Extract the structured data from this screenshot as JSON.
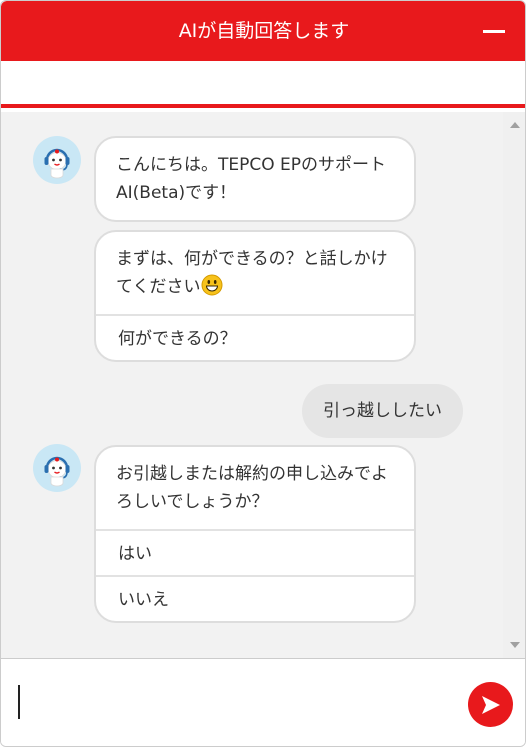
{
  "header": {
    "title": "AIが自動回答します",
    "minimize_icon": "minus-icon"
  },
  "colors": {
    "brand_red": "#e8191c",
    "chat_background": "#f2f2f2",
    "user_bubble": "#e5e5e5",
    "avatar_background": "#c9e7f5"
  },
  "messages": [
    {
      "sender": "bot",
      "avatar_icon": "robot-operator-icon",
      "text": "こんにちは。TEPCO EPのサポートAI(Beta)です！"
    },
    {
      "sender": "bot",
      "text": "まずは、何ができるの？と話しかけてください",
      "emoji_icon": "grinning-face-icon",
      "options": [
        "何ができるの？"
      ]
    },
    {
      "sender": "user",
      "text": "引っ越ししたい"
    },
    {
      "sender": "bot",
      "avatar_icon": "robot-operator-icon",
      "text": "お引越しまたは解約の申し込みでよろしいでしょうか？",
      "options": [
        "はい",
        "いいえ"
      ]
    }
  ],
  "input": {
    "value": "",
    "send_icon": "send-arrow-icon"
  }
}
